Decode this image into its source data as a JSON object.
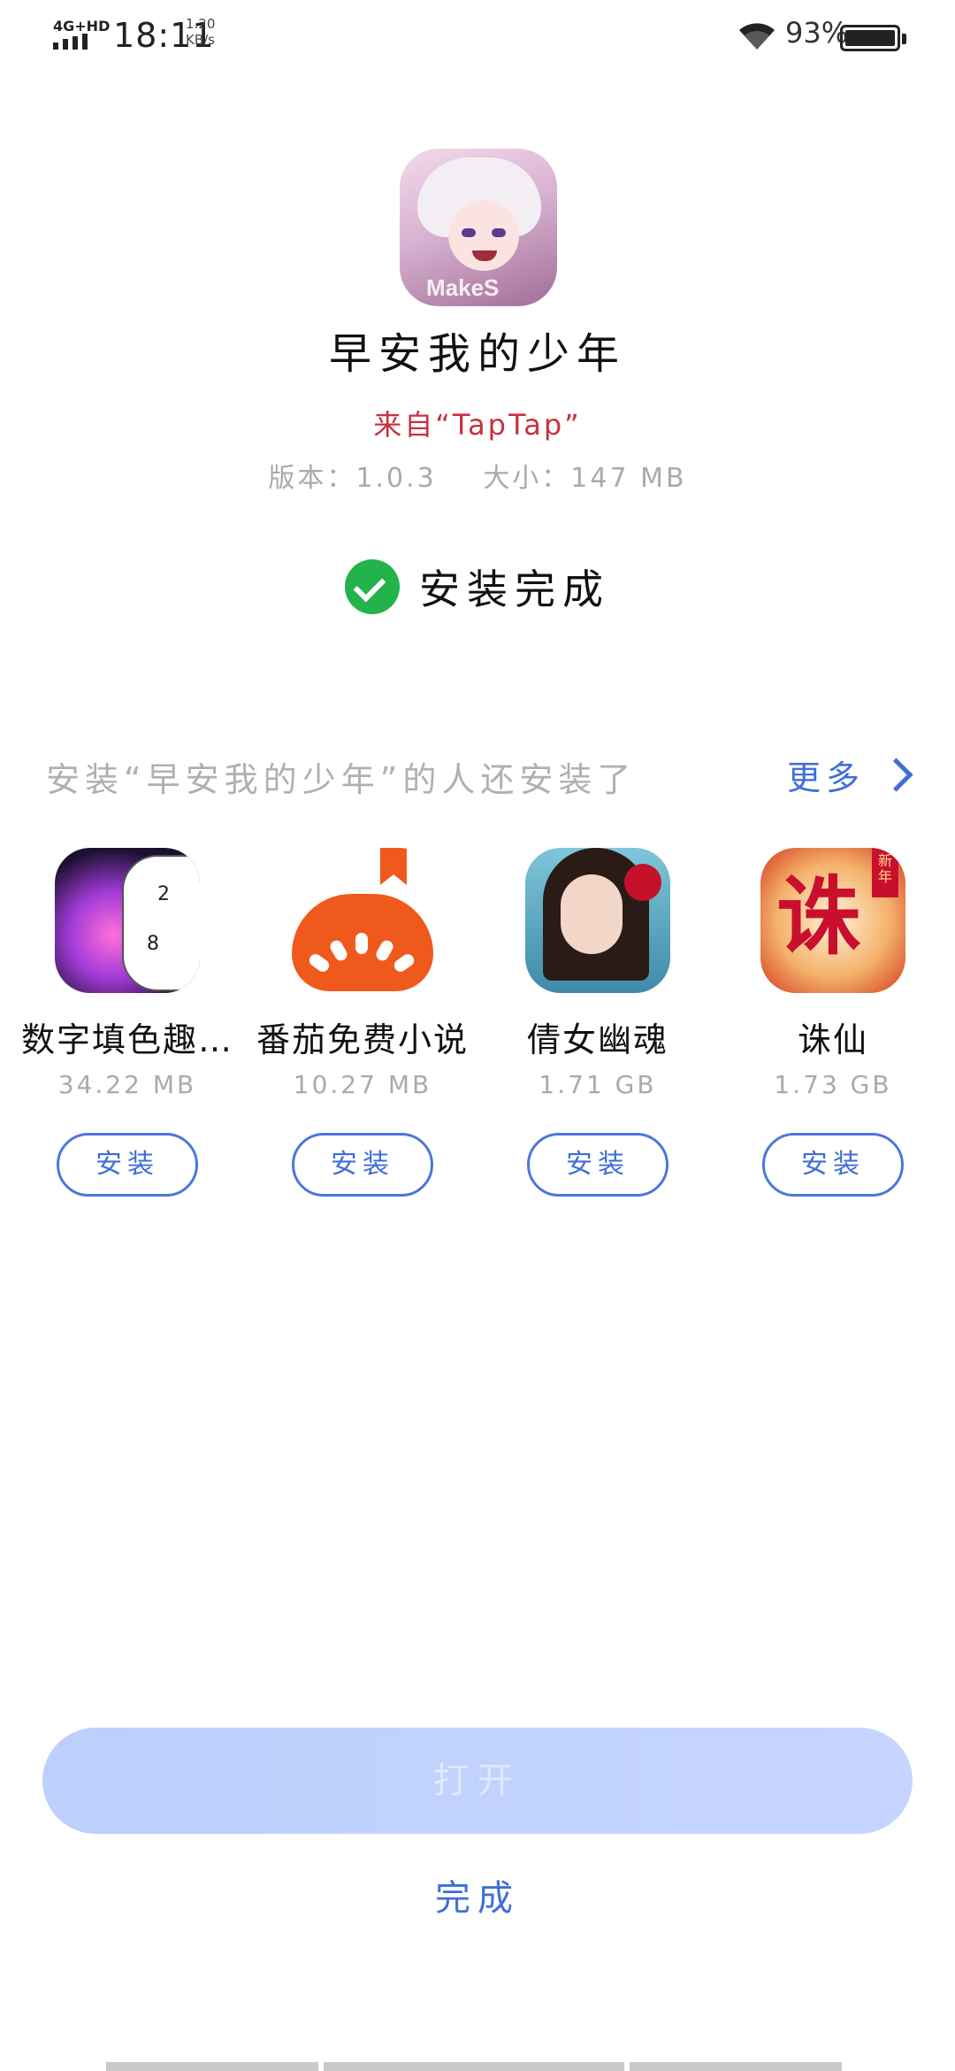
{
  "status_bar": {
    "network": "4G+HD",
    "time": "18:11",
    "speed_value": "1.20",
    "speed_unit": "KB/s",
    "battery_percent": "93%"
  },
  "app": {
    "name": "早安我的少年",
    "source": "来自“TapTap”",
    "version": "版本：1.0.3",
    "size": "大小：147 MB",
    "status": "安装完成"
  },
  "recommend": {
    "title": "安装“早安我的少年”的人还安装了",
    "more_label": "更多",
    "items": [
      {
        "name": "数字填色趣…",
        "size": "34.22 MB",
        "button": "安装",
        "icon": "lotus-icon"
      },
      {
        "name": "番茄免费小说",
        "size": "10.27 MB",
        "button": "安装",
        "icon": "tomato-icon"
      },
      {
        "name": "倩女幽魂",
        "size": "1.71 GB",
        "button": "安装",
        "icon": "girl-icon"
      },
      {
        "name": "诛仙",
        "size": "1.73 GB",
        "button": "安装",
        "icon": "zhuxian-icon"
      }
    ]
  },
  "actions": {
    "open_label": "打开",
    "done_label": "完成"
  },
  "colors": {
    "accent": "#3f6ed8",
    "source_red": "#c8303d",
    "success_green": "#22b34a",
    "open_button": "#c6d5ff"
  },
  "icon_text": {
    "makes": "MakeS",
    "zx_char": "诛",
    "zx_tag": "新年",
    "lotus_n1": "2",
    "lotus_n2": "8"
  }
}
